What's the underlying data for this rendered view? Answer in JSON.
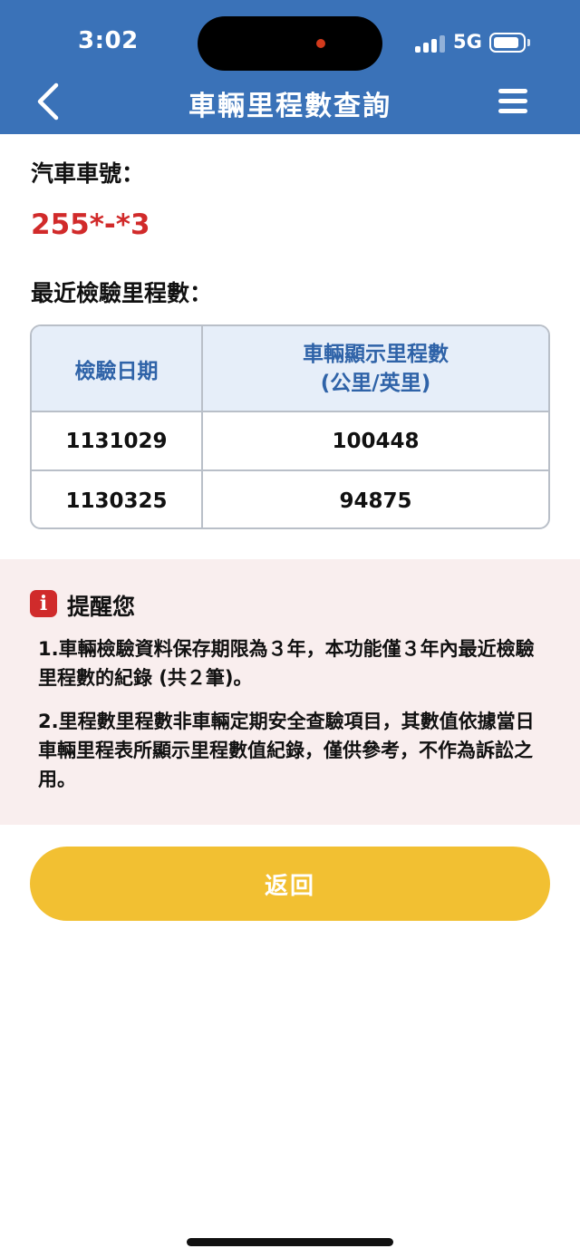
{
  "status_bar": {
    "time": "3:02",
    "network": "5G",
    "signal_icon": "signal-bars-icon",
    "battery_icon": "battery-icon"
  },
  "nav": {
    "title": "車輛里程數查詢",
    "back_icon": "chevron-left-icon",
    "menu_icon": "hamburger-menu-icon",
    "bar_color": "#3a72b8"
  },
  "vehicle": {
    "plate_label": "汽車車號：",
    "plate_value": "255*-*3",
    "plate_color": "#d12a2a"
  },
  "mileage": {
    "section_label": "最近檢驗里程數：",
    "headers": {
      "date": "檢驗日期",
      "mileage_line1": "車輛顯示里程數",
      "mileage_line2": "(公里/英里)"
    },
    "rows": [
      {
        "date": "1131029",
        "mileage": "100448"
      },
      {
        "date": "1130325",
        "mileage": "94875"
      }
    ]
  },
  "notice": {
    "icon": "info-icon",
    "title": "提醒您",
    "items": [
      "1.車輛檢驗資料保存期限為３年，本功能僅３年內最近檢驗里程數的紀錄 (共２筆)。",
      "2.里程數里程數非車輛定期安全查驗項目，其數值依據當日車輛里程表所顯示里程數值紀錄，僅供參考，不作為訴訟之用。"
    ]
  },
  "actions": {
    "return_label": "返回",
    "return_color": "#f2c032"
  }
}
